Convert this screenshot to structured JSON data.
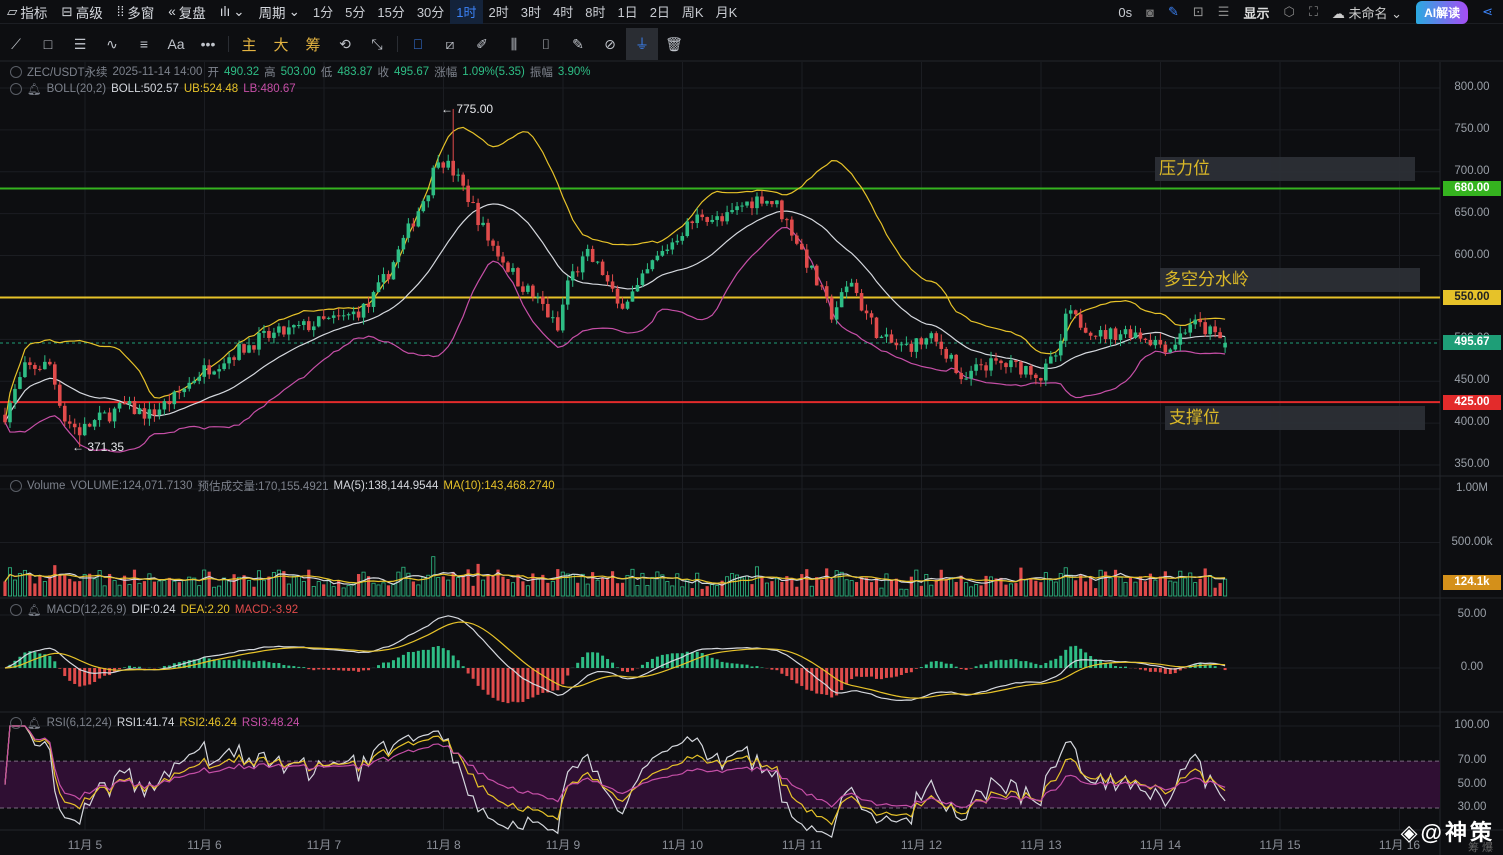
{
  "toolbar": {
    "indicators": "指标",
    "advanced": "高级",
    "multi": "多窗",
    "replay": "复盘",
    "period": "周期",
    "periods": [
      "1分",
      "5分",
      "15分",
      "30分",
      "1时",
      "2时",
      "3时",
      "4时",
      "8时",
      "1日",
      "2日",
      "周K",
      "月K"
    ],
    "active_period": "1时",
    "timer": "0s",
    "display": "显示",
    "layout_name": "未命名",
    "ai": "AI解读",
    "draw_text": "Aa",
    "main": "主",
    "big": "大",
    "chips": "筹"
  },
  "header": {
    "symbol": "ZEC/USDT永续",
    "datetime": "2025-11-14 14:00",
    "open_l": "开",
    "open": "490.32",
    "high_l": "高",
    "high": "503.00",
    "low_l": "低",
    "low": "483.87",
    "close_l": "收",
    "close": "495.67",
    "chg_l": "涨幅",
    "chg": "1.09%(5.35)",
    "amp_l": "振幅",
    "amp": "3.90%"
  },
  "boll": {
    "label": "BOLL(20,2)",
    "mid": "BOLL:502.57",
    "ub": "UB:524.48",
    "lb": "LB:480.67"
  },
  "volume": {
    "label": "Volume",
    "vol": "VOLUME:124,071.7130",
    "est": "预估成交量:170,155.4921",
    "ma5": "MA(5):138,144.9544",
    "ma10": "MA(10):143,468.2740",
    "axis": [
      "1.00M",
      "500.00k"
    ],
    "tag": "124.1k"
  },
  "macd": {
    "label": "MACD(12,26,9)",
    "dif": "DIF:0.24",
    "dea": "DEA:2.20",
    "macd": "MACD:-3.92",
    "axis": [
      "50.00",
      "0.00"
    ]
  },
  "rsi": {
    "label": "RSI(6,12,24)",
    "r1": "RSI1:41.74",
    "r2": "RSI2:46.24",
    "r3": "RSI3:48.24",
    "axis": [
      "100.00",
      "70.00",
      "50.00",
      "30.00"
    ]
  },
  "price_axis": [
    "800.00",
    "750.00",
    "700.00",
    "650.00",
    "600.00",
    "550.00",
    "500.00",
    "450.00",
    "400.00",
    "350.00"
  ],
  "levels": [
    {
      "price": 680,
      "label": "680.00",
      "zone": "压力位",
      "color": "#35b31f"
    },
    {
      "price": 550,
      "label": "550.00",
      "zone": "多空分水岭",
      "color": "#e6c229"
    },
    {
      "price": 425,
      "label": "425.00",
      "zone": "支撑位",
      "color": "#e32b2b"
    }
  ],
  "current_price": {
    "price": 495.67,
    "label": "495.67",
    "color": "#1e9e77"
  },
  "annotations": {
    "high": "← 775.00",
    "low": "← 371.35"
  },
  "dates": [
    "11月 5",
    "11月 6",
    "11月 7",
    "11月 8",
    "11月 9",
    "11月 10",
    "11月 11",
    "11月 12",
    "11月 13",
    "11月 14",
    "11月 15",
    "11月 16"
  ],
  "watermark": "@神策",
  "corner": "筹 爆",
  "chart_data": {
    "type": "candlestick",
    "interval": "1h",
    "start": "11月4 08:00",
    "high": 775.0,
    "low": 371.35,
    "last_close": 495.67,
    "price_range": [
      350,
      800
    ],
    "keypoints": [
      [
        0,
        410
      ],
      [
        4,
        465
      ],
      [
        9,
        470
      ],
      [
        12,
        405
      ],
      [
        15,
        390
      ],
      [
        19,
        405
      ],
      [
        24,
        420
      ],
      [
        29,
        410
      ],
      [
        34,
        430
      ],
      [
        39,
        460
      ],
      [
        45,
        480
      ],
      [
        51,
        500
      ],
      [
        57,
        510
      ],
      [
        63,
        520
      ],
      [
        68,
        525
      ],
      [
        73,
        540
      ],
      [
        77,
        580
      ],
      [
        81,
        630
      ],
      [
        85,
        680
      ],
      [
        87,
        720
      ],
      [
        90,
        700
      ],
      [
        93,
        670
      ],
      [
        97,
        620
      ],
      [
        103,
        570
      ],
      [
        108,
        540
      ],
      [
        111,
        510
      ],
      [
        113,
        570
      ],
      [
        117,
        600
      ],
      [
        120,
        580
      ],
      [
        123,
        540
      ],
      [
        127,
        560
      ],
      [
        130,
        590
      ],
      [
        136,
        630
      ],
      [
        140,
        650
      ],
      [
        144,
        640
      ],
      [
        148,
        660
      ],
      [
        152,
        670
      ],
      [
        155,
        660
      ],
      [
        158,
        630
      ],
      [
        162,
        580
      ],
      [
        166,
        530
      ],
      [
        170,
        570
      ],
      [
        172,
        540
      ],
      [
        176,
        500
      ],
      [
        180,
        490
      ],
      [
        186,
        500
      ],
      [
        190,
        480
      ],
      [
        192,
        445
      ],
      [
        196,
        470
      ],
      [
        200,
        470
      ],
      [
        206,
        465
      ],
      [
        208,
        455
      ],
      [
        212,
        490
      ],
      [
        213,
        530
      ],
      [
        216,
        520
      ],
      [
        220,
        505
      ],
      [
        226,
        510
      ],
      [
        230,
        500
      ],
      [
        234,
        490
      ],
      [
        238,
        520
      ],
      [
        240,
        515
      ],
      [
        243,
        505
      ],
      [
        245,
        495.67
      ]
    ]
  }
}
